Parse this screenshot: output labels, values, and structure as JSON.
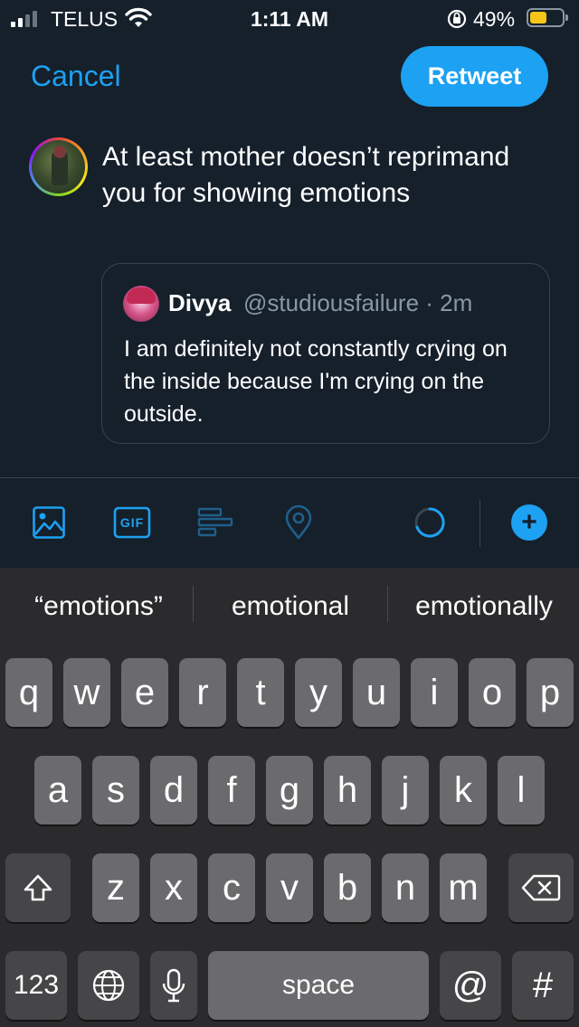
{
  "status_bar": {
    "carrier": "TELUS",
    "time": "1:11 AM",
    "battery_percent": "49%",
    "signal_bars": 2,
    "battery_level": 0.49,
    "icons": [
      "signal-icon",
      "wifi-icon",
      "orientation-lock-icon",
      "battery-icon"
    ]
  },
  "header": {
    "cancel_label": "Cancel",
    "retweet_label": "Retweet"
  },
  "composer": {
    "text": "At least mother doesn’t reprimand you for showing emotions"
  },
  "quoted_tweet": {
    "name": "Divya",
    "handle_time": "@studiousfailure · 2m",
    "body": "I am definitely not constantly crying on the inside because I'm crying on the outside."
  },
  "toolbar": {
    "icons": [
      "image-icon",
      "gif-icon",
      "poll-icon",
      "location-icon",
      "char-counter-ring",
      "add-tweet-icon"
    ],
    "gif_label": "GIF",
    "add_label": "+",
    "colors": {
      "accent": "#1da1f2",
      "muted": "#1f5f8b"
    }
  },
  "keyboard": {
    "suggestions": [
      "“emotions”",
      "emotional",
      "emotionally"
    ],
    "row1": [
      "q",
      "w",
      "e",
      "r",
      "t",
      "y",
      "u",
      "i",
      "o",
      "p"
    ],
    "row2": [
      "a",
      "s",
      "d",
      "f",
      "g",
      "h",
      "j",
      "k",
      "l"
    ],
    "row3": [
      "z",
      "x",
      "c",
      "v",
      "b",
      "n",
      "m"
    ],
    "numbers_label": "123",
    "space_label": "space",
    "at_label": "@",
    "hash_label": "#",
    "icons": [
      "shift-icon",
      "backspace-icon",
      "globe-icon",
      "microphone-icon"
    ]
  }
}
